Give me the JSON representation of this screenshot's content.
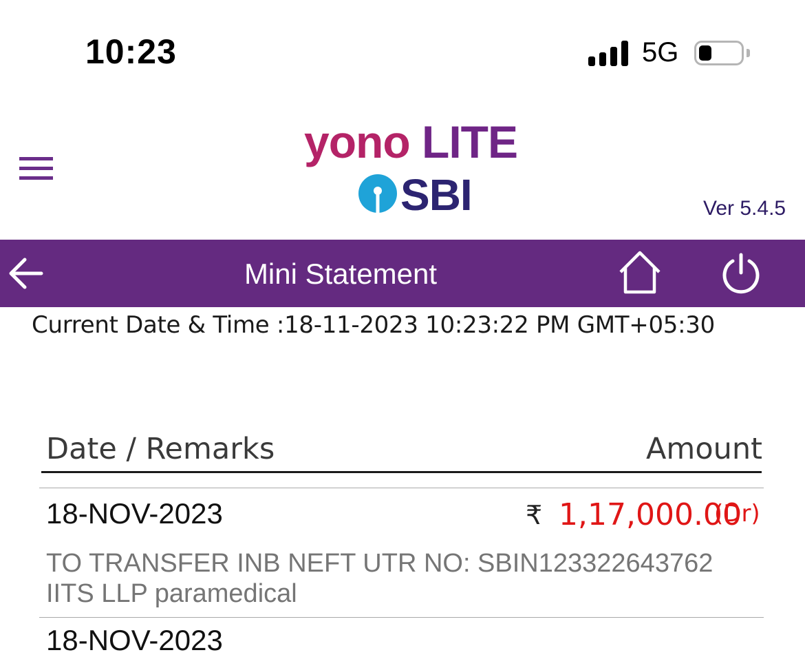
{
  "status_bar": {
    "time": "10:23",
    "network": "5G",
    "battery_level": 0.2
  },
  "header": {
    "logo_yono": "yono",
    "logo_lite": "LITE",
    "logo_bank": "SBI",
    "version": "Ver 5.4.5"
  },
  "titlebar": {
    "title": "Mini Statement"
  },
  "current_datetime": "Current Date & Time :18-11-2023 10:23:22 PM GMT+05:30",
  "table": {
    "columns": [
      "Date / Remarks",
      "Amount"
    ],
    "rows": [
      {
        "date": "18-NOV-2023",
        "currency_symbol": "₹",
        "amount": "1,17,000.00",
        "type": "(Dr)",
        "remarks_line1": "TO TRANSFER INB NEFT UTR NO: SBIN123322643762",
        "remarks_line2": "IITS LLP paramedical"
      },
      {
        "date": "18-NOV-2023"
      }
    ]
  },
  "colors": {
    "brand_purple": "#642a80",
    "debit_red": "#e01616",
    "sbi_blue": "#2c2471",
    "sbi_cyan": "#1fa3d8"
  }
}
